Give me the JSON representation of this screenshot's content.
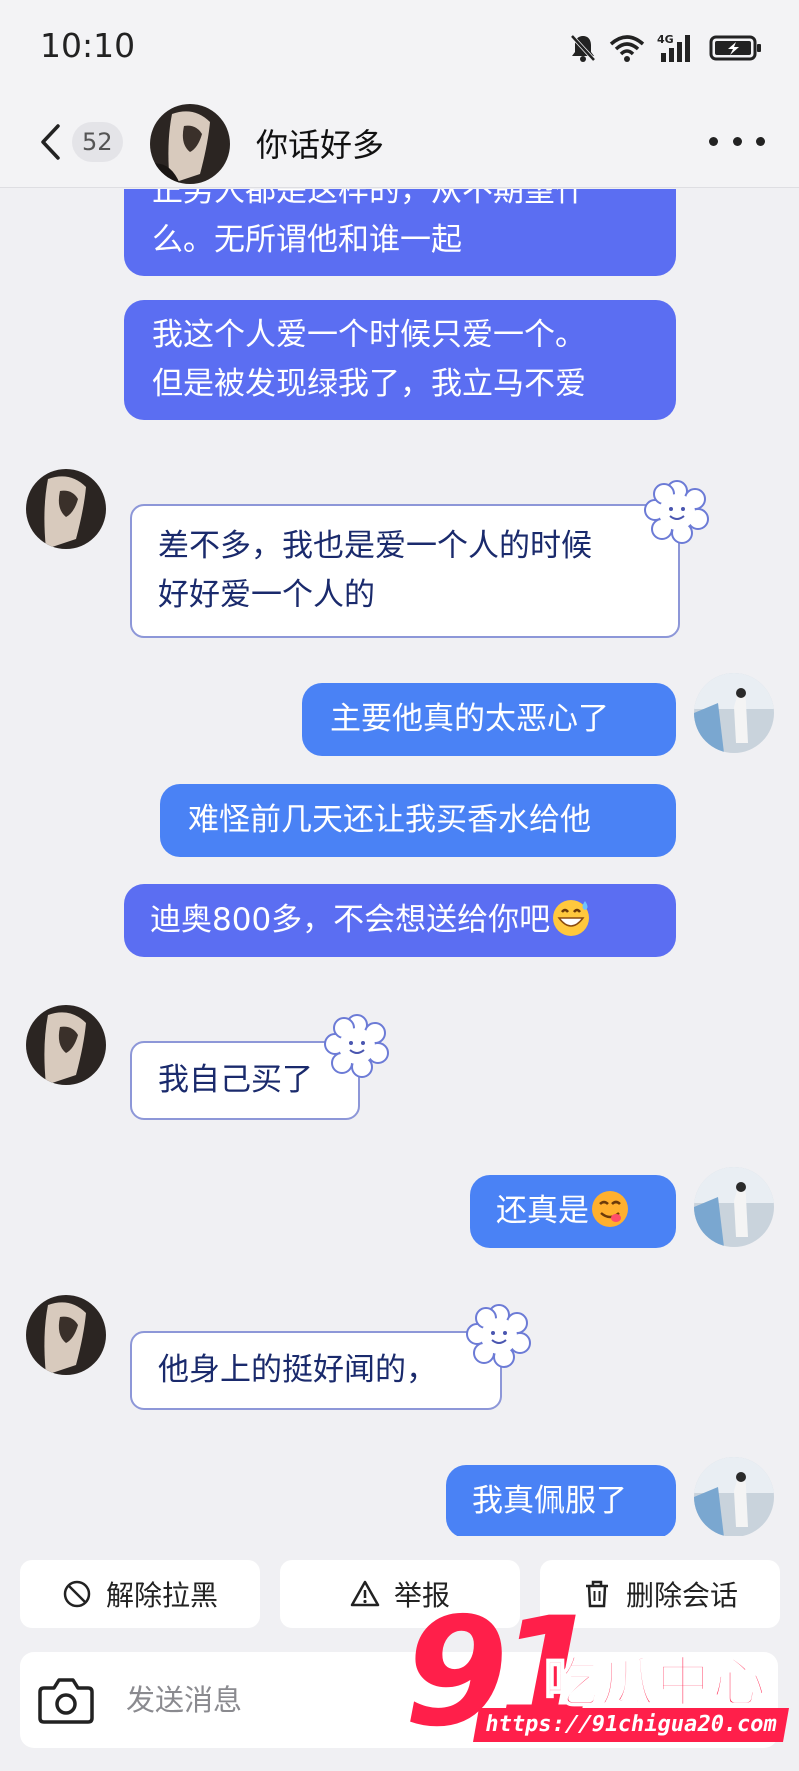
{
  "status_bar": {
    "time": "10:10",
    "icons": [
      "bell-off-icon",
      "wifi-icon",
      "signal-4g-icon",
      "battery-charging-icon"
    ],
    "network_label": "4G"
  },
  "header": {
    "back_icon": "chevron-left-icon",
    "unread_count": "52",
    "title": "你话好多",
    "more_icon": "more-horizontal-icon"
  },
  "messages": [
    {
      "side": "out",
      "text_lines": [
        "正男人都是这样的，从不期望什",
        "么。无所谓他和谁一起"
      ]
    },
    {
      "side": "out",
      "text_lines": [
        "我这个人爱一个时候只爱一个。",
        "但是被发现绿我了，我立马不爱"
      ]
    },
    {
      "side": "in",
      "text_lines": [
        "差不多，我也是爱一个人的时候",
        "好好爱一个人的"
      ]
    },
    {
      "side": "out",
      "text_lines": [
        "主要他真的太恶心了"
      ]
    },
    {
      "side": "out",
      "text_lines": [
        "难怪前几天还让我买香水给他"
      ]
    },
    {
      "side": "out",
      "text_lines": [
        "迪奥800多，不会想送给你吧"
      ],
      "emoji": "grinning-sweat-emoji"
    },
    {
      "side": "in",
      "text_lines": [
        "我自己买了"
      ]
    },
    {
      "side": "out",
      "text_lines": [
        "还真是"
      ],
      "emoji": "yum-emoji"
    },
    {
      "side": "in",
      "text_lines": [
        "他身上的挺好闻的，"
      ]
    },
    {
      "side": "out",
      "text_lines": [
        "我真佩服了"
      ]
    }
  ],
  "actions": [
    {
      "label": "解除拉黑",
      "icon": "block-icon"
    },
    {
      "label": "举报",
      "icon": "warning-icon"
    },
    {
      "label": "删除会话",
      "icon": "trash-icon"
    }
  ],
  "composer": {
    "camera_icon": "camera-icon",
    "placeholder": "发送消息"
  },
  "watermark": {
    "digits": "91",
    "text": "吃瓜中心",
    "url": "https://91chigua20.com"
  },
  "colors": {
    "outgoing_bubble": "#5b6ef2",
    "outgoing_bubble_alt": "#4a82f5",
    "incoming_border": "#8d97d8",
    "incoming_text": "#1a2a6c",
    "watermark": "#ff1f4a"
  }
}
